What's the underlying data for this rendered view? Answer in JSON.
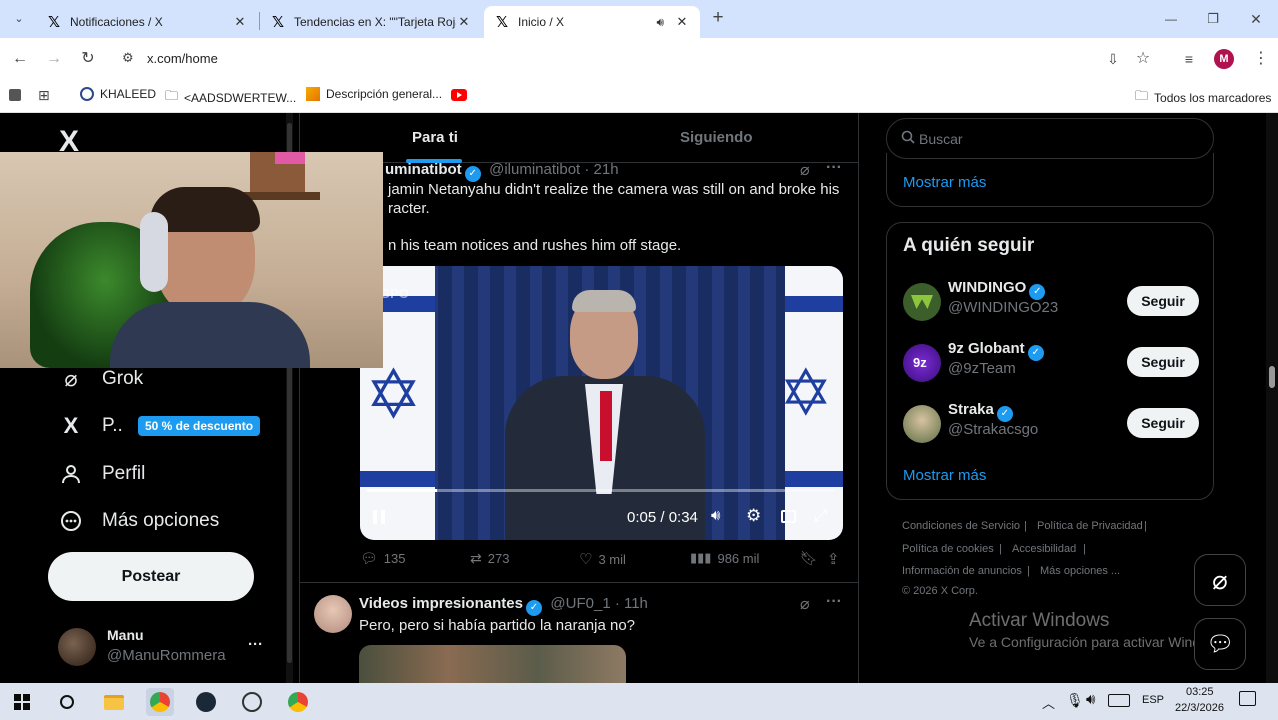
{
  "browser": {
    "tabs": [
      {
        "title": "Notificaciones / X",
        "close": "✕"
      },
      {
        "title": "Tendencias en X: \"\"Tarjeta Roja\"",
        "close": "✕"
      },
      {
        "title": "Inicio / X",
        "close": "✕",
        "active": true
      }
    ],
    "new_tab": "+",
    "window_controls": {
      "minimize": "—",
      "restore": "❐",
      "close": "✕"
    },
    "url": "x.com/home",
    "profile_initial": "M",
    "bookmarks": [
      {
        "label": "KHALEED"
      },
      {
        "label": "<AADSDWERTEW..."
      },
      {
        "label": "Descripción general..."
      }
    ],
    "all_bookmarks": "Todos los marcadores"
  },
  "x": {
    "logo": "X",
    "nav": {
      "grok": "Grok",
      "premium": "P..",
      "premium_badge": "50 % de descuento",
      "profile": "Perfil",
      "more": "Más opciones"
    },
    "post_button": "Postear",
    "account": {
      "name": "Manu",
      "handle": "@ManuRommera",
      "more": "···"
    },
    "feed_tabs": {
      "for_you": "Para ti",
      "following": "Siguiendo"
    },
    "tweet1": {
      "name": "uminatibot",
      "handle": "@iluminatibot · 21h",
      "text1": "jamin Netanyahu didn't realize the camera was still on and broke his",
      "text2": "racter.",
      "text3": "n his team notices and rushes him off stage.",
      "watermark": "GPO",
      "time": "0:05 / 0:34",
      "progress": 0.15,
      "stats": {
        "replies": "135",
        "reposts": "273",
        "likes": "3 mil",
        "views": "986 mil"
      }
    },
    "tweet2": {
      "name": "Videos impresionantes",
      "handle": "@UF0_1 · 11h",
      "text": "Pero, pero si había partido la naranja no?"
    },
    "search_placeholder": "Buscar",
    "show_more_1": "Mostrar más",
    "who_to_follow": {
      "title": "A quién seguir",
      "accounts": [
        {
          "name": "WINDINGO",
          "handle": "@WINDINGO23",
          "button": "Seguir"
        },
        {
          "name": "9z Globant",
          "handle": "@9zTeam",
          "button": "Seguir"
        },
        {
          "name": "Straka",
          "handle": "@Strakacsgo",
          "button": "Seguir"
        }
      ],
      "show_more": "Mostrar más"
    },
    "footer": {
      "terms": "Condiciones de Servicio",
      "privacy": "Política de Privacidad",
      "cookies": "Política de cookies",
      "accessibility": "Accesibilidad",
      "ads": "Información de anuncios",
      "more": "Más opciones ...",
      "copyright": "© 2026 X Corp."
    },
    "windows_watermark": {
      "title": "Activar Windows",
      "subtitle": "Ve a Configuración para activar Windows."
    }
  },
  "taskbar": {
    "language": "ESP",
    "time": "03:25",
    "date": "22/3/2026"
  }
}
